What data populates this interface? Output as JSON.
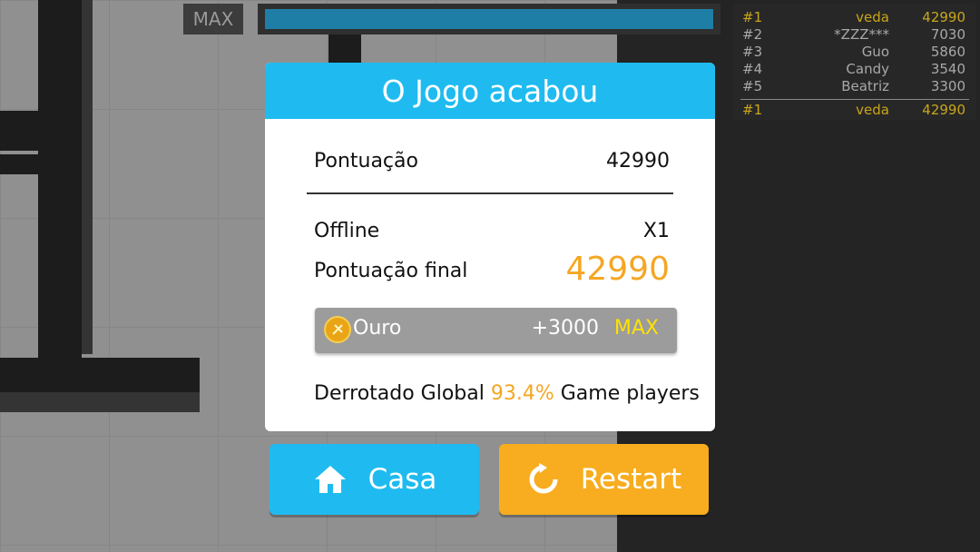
{
  "hud": {
    "max_label": "MAX",
    "progress_fraction": 1.0,
    "colors": {
      "progress_fill": "#1f7ea6"
    }
  },
  "leaderboard": {
    "rows": [
      {
        "rank": "#1",
        "name": "veda",
        "score": "42990",
        "highlight": true
      },
      {
        "rank": "#2",
        "name": "*ZZZ***",
        "score": "7030",
        "highlight": false
      },
      {
        "rank": "#3",
        "name": "Guo",
        "score": "5860",
        "highlight": false
      },
      {
        "rank": "#4",
        "name": "Candy",
        "score": "3540",
        "highlight": false
      },
      {
        "rank": "#5",
        "name": "Beatriz",
        "score": "3300",
        "highlight": false
      }
    ],
    "me": {
      "rank": "#1",
      "name": "veda",
      "score": "42990"
    }
  },
  "dialog": {
    "title": "O Jogo acabou",
    "score_label": "Pontuação",
    "score_value": "42990",
    "mode_label": "Offline",
    "multiplier": "X1",
    "final_label": "Pontuação final",
    "final_value": "42990",
    "gold": {
      "icon": "coin-icon",
      "label": "Ouro",
      "amount": "+3000",
      "max": "MAX"
    },
    "global": {
      "prefix": "Derrotado Global",
      "percent": "93.4%",
      "suffix": "Game players"
    },
    "colors": {
      "header": "#1fbbf0",
      "highlight": "#f5a623",
      "max": "#ffe100"
    }
  },
  "buttons": {
    "home": {
      "icon": "home-icon",
      "label": "Casa",
      "color": "#1fbbf0"
    },
    "restart": {
      "icon": "restart-icon",
      "label": "Restart",
      "color": "#f7ad1f"
    }
  }
}
